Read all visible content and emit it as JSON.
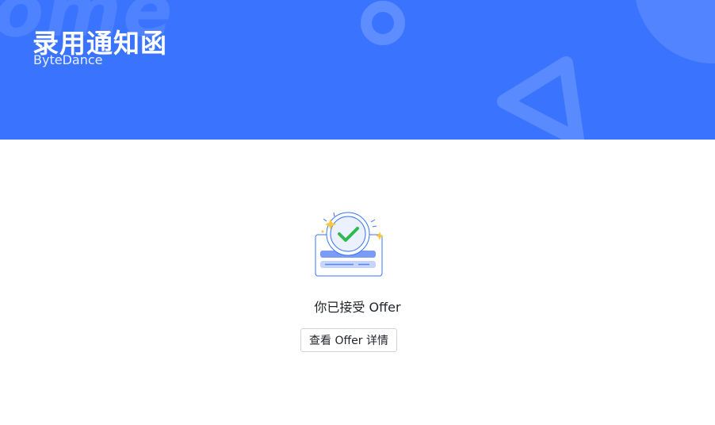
{
  "banner": {
    "title": "录用通知函",
    "subtitle": "ByteDance",
    "watermark": "ome",
    "background_color": "#3a74fe"
  },
  "status": {
    "icon": "check-circle-icon",
    "text": "你已接受 Offer",
    "accent_color": "#2fb94f"
  },
  "actions": {
    "view_offer_label": "查看 Offer 详情"
  }
}
